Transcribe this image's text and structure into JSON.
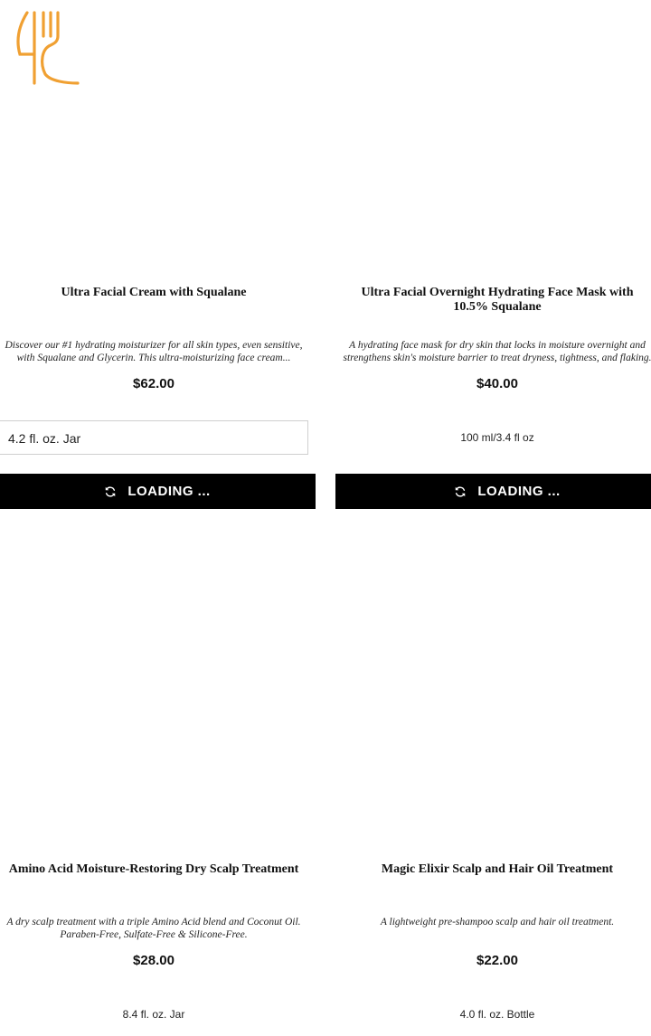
{
  "brand": {
    "logo_color": "#F0A032",
    "logo_icon": "fork-knife-logo-icon"
  },
  "products": [
    {
      "title": "Ultra Facial Cream with Squalane",
      "desc_lines": [
        "Discover our #1 hydrating moisturizer for all skin types, even sensitive,",
        "with Squalane and Glycerin. This ultra-moisturizing face cream..."
      ],
      "price": "$62.00",
      "size": "4.2 fl. oz. Jar",
      "size_is_select": true,
      "button": "LOADING ..."
    },
    {
      "title": "Ultra Facial Overnight Hydrating Face Mask with 10.5% Squalane",
      "desc_lines": [
        "A hydrating face mask for dry skin that locks in moisture overnight and",
        "strengthens skin's moisture barrier to treat dryness, tightness, and flaking."
      ],
      "price": "$40.00",
      "size": "100 ml/3.4 fl oz",
      "size_is_select": false,
      "button": "LOADING ..."
    },
    {
      "title": "Amino Acid Moisture-Restoring Dry Scalp Treatment",
      "desc_lines": [
        "A dry scalp treatment with a triple Amino Acid blend and Coconut Oil.",
        "Paraben-Free, Sulfate-Free & Silicone-Free."
      ],
      "price": "$28.00",
      "size": "8.4 fl. oz. Jar",
      "size_is_select": false
    },
    {
      "title": "Magic Elixir Scalp and Hair Oil Treatment",
      "desc_lines": [
        "A lightweight pre-shampoo scalp and hair oil treatment."
      ],
      "price": "$22.00",
      "size": "4.0 fl. oz. Bottle",
      "size_is_select": false
    }
  ]
}
